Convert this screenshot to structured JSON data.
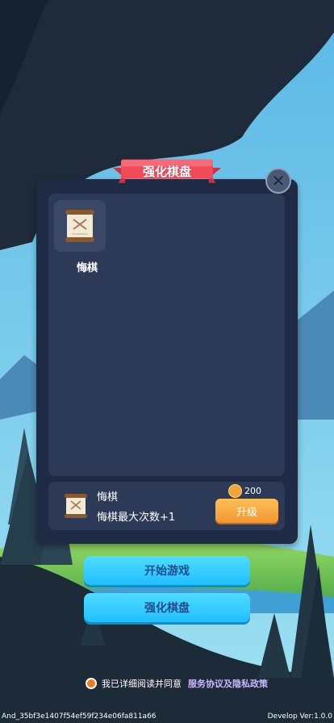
{
  "title": "强化棋盘",
  "close_icon": "close-icon",
  "item": {
    "name": "悔棋",
    "icon": "scroll-icon"
  },
  "detail": {
    "title": "悔棋",
    "desc": "悔棋最大次数+1",
    "price": "200",
    "upgrade_label": "升级",
    "icon": "scroll-icon"
  },
  "buttons": {
    "start": "开始游戏",
    "enhance": "强化棋盘"
  },
  "agreement": {
    "text": "我已详细阅读并同意",
    "link": "服务协议及隐私政策"
  },
  "footer": {
    "id": "And_35bf3e1407f54ef59f234e06fa811a66",
    "version": "Develop Ver:1.0.0"
  },
  "colors": {
    "accent_orange": "#f19632",
    "button_blue": "#21bfff",
    "ribbon_red": "#f04b5a"
  }
}
